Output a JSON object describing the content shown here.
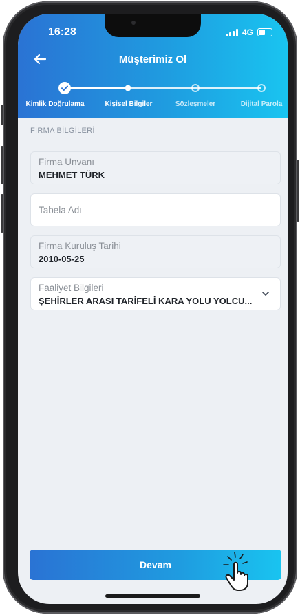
{
  "status": {
    "time": "16:28",
    "network": "4G"
  },
  "header": {
    "title": "Müşterimiz Ol"
  },
  "stepper": {
    "steps": [
      {
        "label": "Kimlik Doğrulama",
        "state": "done"
      },
      {
        "label": "Kişisel Bilgiler",
        "state": "current"
      },
      {
        "label": "Sözleşmeler",
        "state": "upcoming"
      },
      {
        "label": "Dijital Parola",
        "state": "upcoming"
      }
    ]
  },
  "form": {
    "section_title": "FİRMA BİLGİLERİ",
    "company_title": {
      "label": "Firma Unvanı",
      "value": "MEHMET TÜRK"
    },
    "sign_name": {
      "placeholder": "Tabela Adı"
    },
    "founding_date": {
      "label": "Firma Kuruluş Tarihi",
      "value": "2010-05-25"
    },
    "activity": {
      "label": "Faaliyet Bilgileri",
      "value": "ŞEHİRLER ARASI TARİFELİ KARA YOLU YOLCU..."
    }
  },
  "footer": {
    "continue_label": "Devam"
  },
  "colors": {
    "brand_start": "#2a73d4",
    "brand_end": "#19c4f0",
    "background": "#edf0f4"
  }
}
